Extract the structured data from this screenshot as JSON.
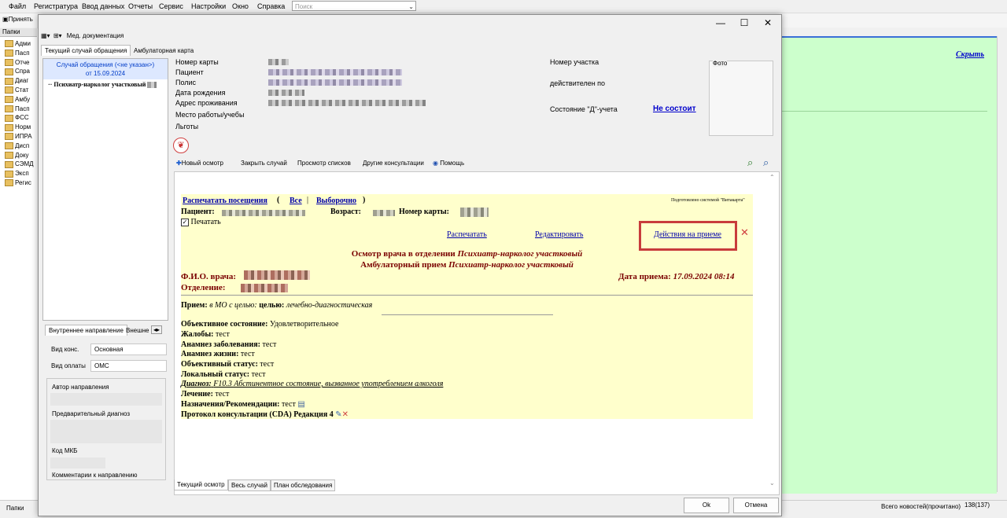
{
  "app": {
    "menu": [
      "Файл",
      "Регистратура",
      "Ввод данных",
      "Отчеты",
      "Сервис",
      "Настройки",
      "Окно",
      "Справка"
    ],
    "search_placeholder": "Поиск",
    "accept_button": "Принять",
    "folders_title": "Папки",
    "folders": [
      "Адми",
      "Пасп",
      "Отче",
      "Спра",
      "Диаг",
      "Стат",
      "Амбу",
      "Пасп",
      "ФСС",
      "Норм",
      "ИПРА",
      "Дисп",
      "Доку",
      "СЭМД",
      "Эксп",
      "Регис"
    ],
    "hide_link": "Скрыть",
    "status_left": "Папки",
    "news_label": "Всего новостей(прочитано)",
    "news_count": "138(137)"
  },
  "dialog": {
    "toolbar_label": "Мед. документация",
    "tabs": [
      "Текущий случай обращения",
      "Амбулаторная карта"
    ],
    "case_line1": "Случай обращения (<не указан>)",
    "case_line2": "от 15.09.2024",
    "tree_item": "Психиатр-нарколог участковый",
    "patient_fields": [
      "Номер карты",
      "Пациент",
      "Полис",
      "Дата рождения",
      "Адрес проживания",
      "Место работы/учебы",
      "Льготы"
    ],
    "plot_label": "Номер участка",
    "valid_label": "действителен по",
    "d_status_label": "Состояние \"Д\"-учета",
    "d_status_value": "Не состоит",
    "photo_label": "Фото",
    "actions": [
      "Новый осмотр",
      "Закрыть случай",
      "Просмотр списков",
      "Другие консультации",
      "Помощь"
    ],
    "referral_tabs": [
      "Внутреннее направление",
      "Внешне"
    ],
    "consult_type_label": "Вид конс.",
    "consult_type_value": "Основная",
    "payment_label": "Вид оплаты",
    "payment_value": "ОМС",
    "referral_author_label": "Автор направления",
    "prelim_diag_label": "Предварительный диагноз",
    "mkb_label": "Код МКБ",
    "comment_label": "Комментарии к направлению",
    "bottom_tabs": [
      "Текущий осмотр",
      "Весь случай",
      "План обследования"
    ],
    "ok_button": "Ok",
    "cancel_button": "Отмена"
  },
  "document": {
    "print_visits": "Распечатать посещения",
    "all": "Все",
    "selective": "Выборочно",
    "prepared_by": "Подготовлено системой \"Витакарта\"",
    "patient_label": "Пациент:",
    "age_label": "Возраст:",
    "card_label": "Номер карты:",
    "print_checkbox": "Печатать",
    "print_checked": true,
    "print_link": "Распечатать",
    "edit_link": "Редактировать",
    "actions_link": "Действия на приеме",
    "title1_prefix": "Осмотр врача в отделении ",
    "title1_italic": "Психиатр-нарколог участковый",
    "title2_prefix": "Амбулаторный прием ",
    "title2_italic": "Психиатр-нарколог участковый",
    "doctor_label": "Ф.И.О. врача:",
    "visit_date_label": "Дата приема:",
    "visit_date_value": "17.09.2024 08:14",
    "department_label": "Отделение:",
    "reception_label": "Прием:",
    "reception_value": "в МО с целью:",
    "reception_purpose": "лечебно-диагностическая",
    "objective_label": "Объективное состояние:",
    "objective_value": "Удовлетворительное",
    "complaints_label": "Жалобы:",
    "complaints_value": "тест",
    "anamnesis_disease_label": "Анамнез заболевания:",
    "anamnesis_disease_value": "тест",
    "anamnesis_life_label": "Анамнез жизни:",
    "anamnesis_life_value": "тест",
    "objective_status_label": "Объективный статус:",
    "objective_status_value": "тест",
    "local_status_label": "Локальный статус:",
    "local_status_value": "тест",
    "diagnosis_label": "Диагноз:",
    "diagnosis_value": "F10.3 Абстинентное состояние, вызванное употреблением алкоголя",
    "treatment_label": "Лечение:",
    "treatment_value": "тест",
    "prescriptions_label": "Назначения/Рекомендации:",
    "prescriptions_value": "тест",
    "protocol_label": "Протокол консультации (CDA) Редакция 4"
  }
}
